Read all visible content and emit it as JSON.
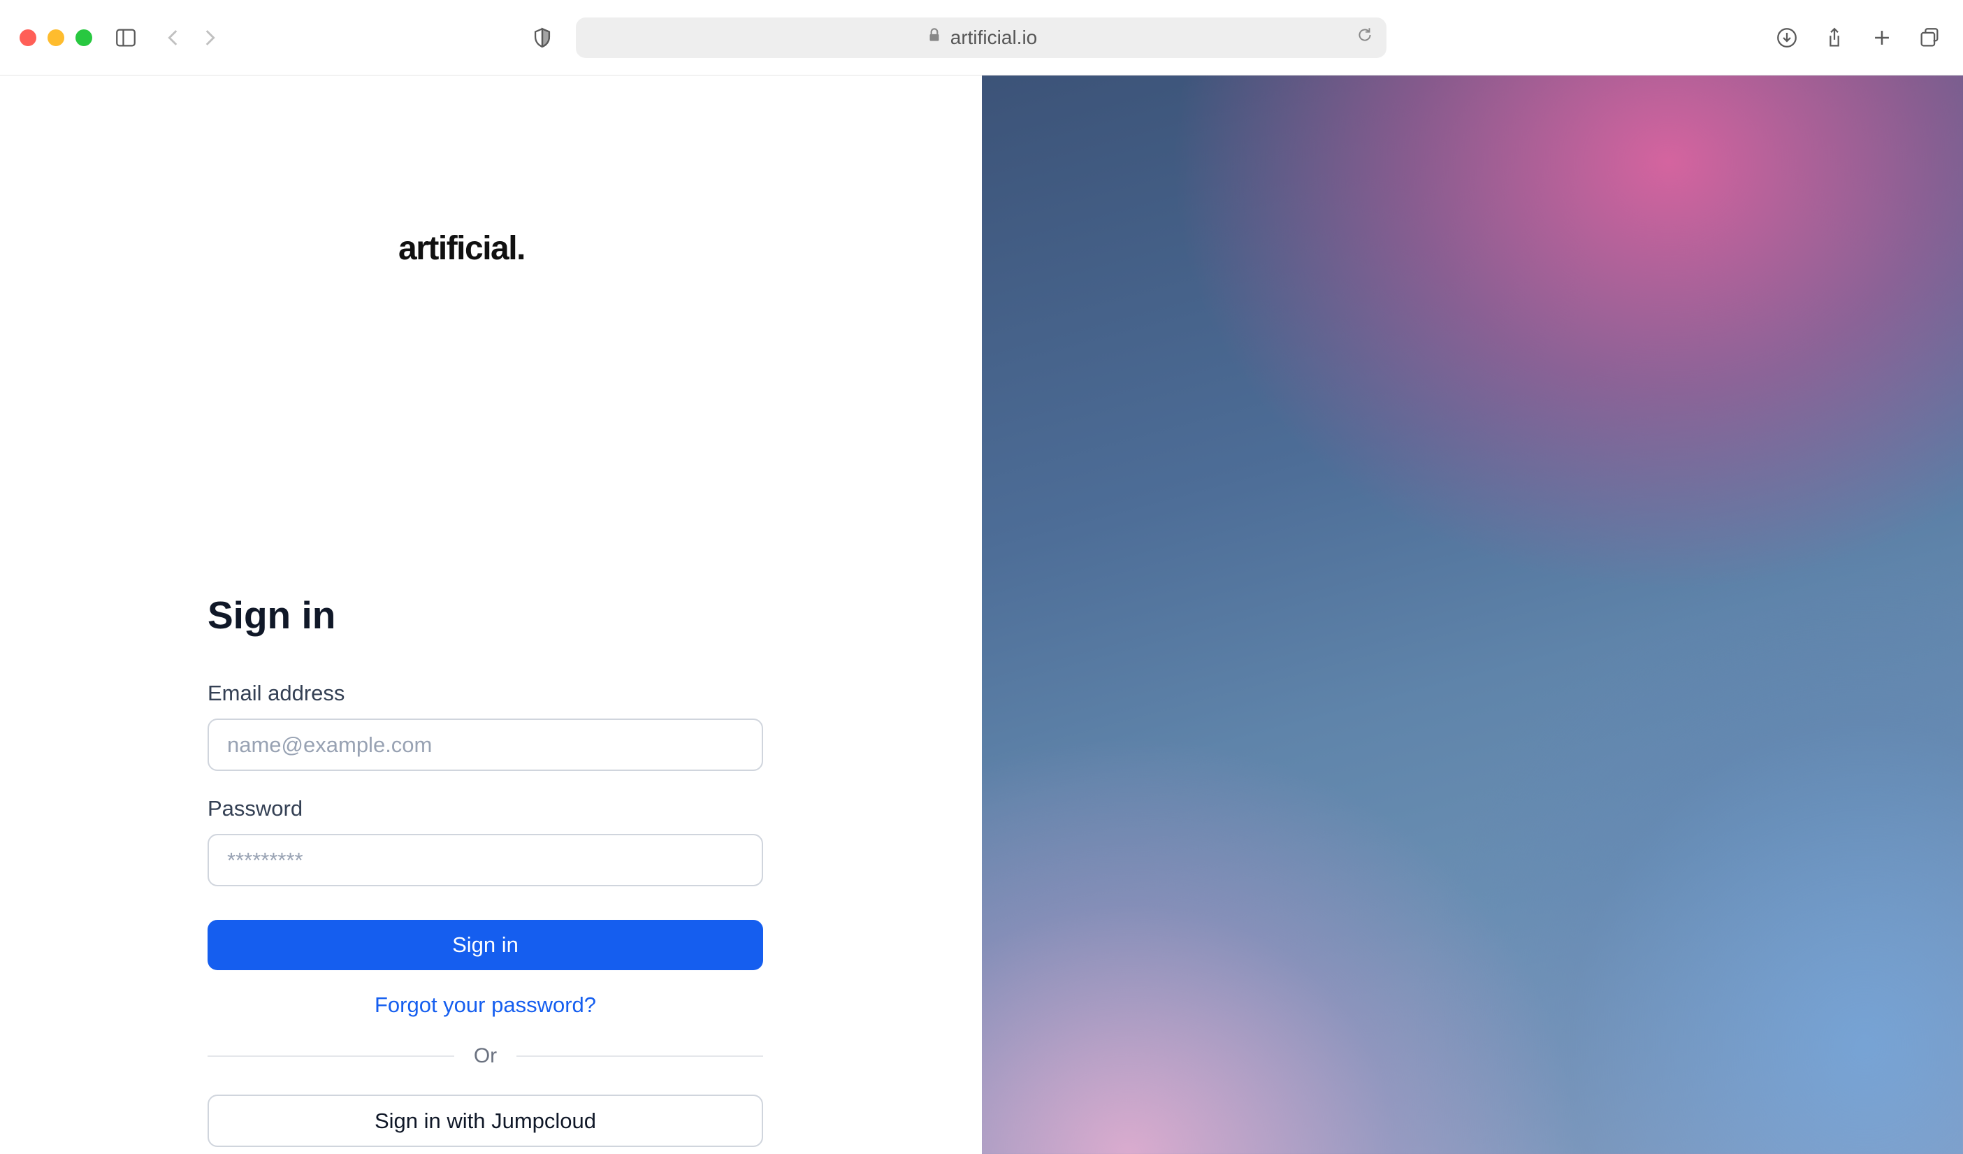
{
  "browser": {
    "url": "artificial.io"
  },
  "page": {
    "brand": "artificial.",
    "heading": "Sign in",
    "email": {
      "label": "Email address",
      "placeholder": "name@example.com",
      "value": ""
    },
    "password": {
      "label": "Password",
      "placeholder": "*********",
      "value": ""
    },
    "signin_button": "Sign in",
    "forgot_link": "Forgot your password?",
    "divider": "Or",
    "sso_button": "Sign in with Jumpcloud"
  }
}
